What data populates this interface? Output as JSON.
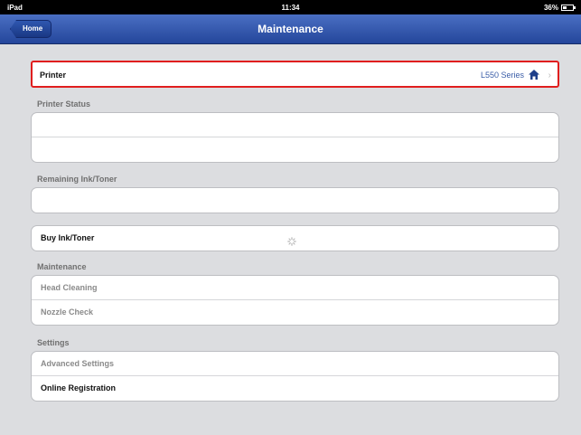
{
  "statusbar": {
    "device": "iPad",
    "time": "11:34",
    "battery": "36%",
    "battery_level": 0.36
  },
  "navbar": {
    "back_label": "Home",
    "title": "Maintenance"
  },
  "printer": {
    "label": "Printer",
    "value": "L550 Series",
    "icon": "house-icon"
  },
  "sections": {
    "printer_status": "Printer Status",
    "remaining_ink": "Remaining Ink/Toner",
    "maintenance": "Maintenance",
    "settings": "Settings"
  },
  "buy_ink": {
    "label": "Buy Ink/Toner"
  },
  "maintenance_items": [
    "Head Cleaning",
    "Nozzle Check"
  ],
  "settings_items": [
    "Advanced Settings",
    "Online Registration"
  ],
  "colors": {
    "nav": "#24469b",
    "highlight": "#e01e1e",
    "link": "#3b5ea8"
  }
}
